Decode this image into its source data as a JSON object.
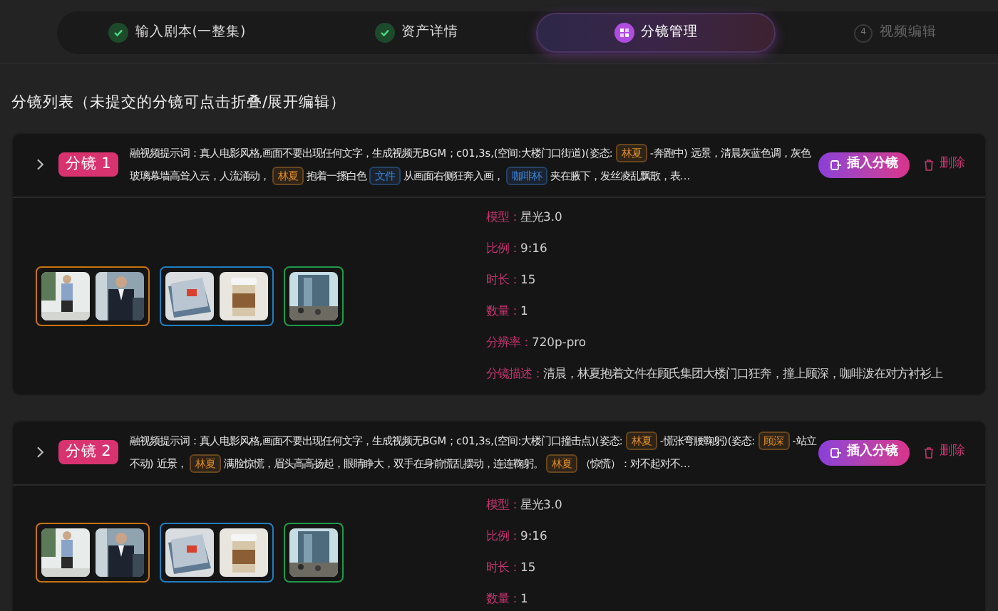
{
  "stepper": [
    {
      "label": "输入剧本(一整集)",
      "selected": false,
      "completed": true
    },
    {
      "label": "资产详情",
      "selected": false,
      "completed": true
    },
    {
      "label": "分镜管理",
      "selected": true,
      "completed": false
    },
    {
      "label": "视频编辑",
      "selected": false,
      "completed": false,
      "number": "4"
    }
  ],
  "list_title": "分镜列表（未提交的分镜可点击折叠/展开编辑）",
  "shots": [
    {
      "badge": "分镜 1",
      "insert_button": "插入分镜",
      "delete_button": "删除",
      "prompt": [
        {
          "kind": "text",
          "text": "融视频提示词：真人电影风格,画面不要出现任何文字，生成视频无BGM；c01,3s,(空间:大楼门口街道)(姿态:"
        },
        {
          "kind": "tag",
          "text": "林夏",
          "color": "#d98a2b"
        },
        {
          "kind": "text",
          "text": "-奔跑中) 远景，清晨灰蓝色调，灰色玻璃幕墙高耸入云，人流涌动，"
        },
        {
          "kind": "tag",
          "text": "林夏",
          "color": "#d98a2b"
        },
        {
          "kind": "text",
          "text": "抱着一摞白色"
        },
        {
          "kind": "tag",
          "text": "文件",
          "color": "#3b82d6"
        },
        {
          "kind": "text",
          "text": "从画面右侧狂奔入画，"
        },
        {
          "kind": "tag",
          "text": "咖啡杯",
          "color": "#3b82d6"
        },
        {
          "kind": "text",
          "text": "夹在腋下，发丝凌乱飘散，表…"
        }
      ],
      "image_groups": [
        {
          "color": "#c8740f"
        },
        {
          "color": "#1f7fc0"
        },
        {
          "color": "#1f9a4a"
        }
      ],
      "details": [
        {
          "label": "模型：",
          "value": "星光3.0"
        },
        {
          "label": "比例：",
          "value": "9:16"
        },
        {
          "label": "时长：",
          "value": "15"
        },
        {
          "label": "数量：",
          "value": "1"
        },
        {
          "label": "分辨率：",
          "value": "720p-pro"
        },
        {
          "label": "分镜描述：",
          "value": "清晨，林夏抱着文件在顾氏集团大楼门口狂奔，撞上顾深，咖啡泼在对方衬衫上"
        }
      ]
    },
    {
      "badge": "分镜 2",
      "insert_button": "插入分镜",
      "delete_button": "删除",
      "prompt": [
        {
          "kind": "text",
          "text": "融视频提示词：真人电影风格,画面不要出现任何文字，生成视频无BGM；c01,3s,(空间:大楼门口撞击点)(姿态:"
        },
        {
          "kind": "tag",
          "text": "林夏",
          "color": "#d98a2b"
        },
        {
          "kind": "text",
          "text": "-慌张弯腰鞠躬)(姿态:"
        },
        {
          "kind": "tag",
          "text": "顾深",
          "color": "#d98a2b"
        },
        {
          "kind": "text",
          "text": "-站立不动) 近景，"
        },
        {
          "kind": "tag",
          "text": "林夏",
          "color": "#d98a2b"
        },
        {
          "kind": "text",
          "text": "满脸惊慌，眉头高高扬起，眼睛睁大，双手在身前慌乱摆动，连连鞠躬。"
        },
        {
          "kind": "tag",
          "text": "林夏",
          "color": "#d98a2b"
        },
        {
          "kind": "text",
          "text": "（惊慌）：对不起对不…"
        }
      ],
      "image_groups": [
        {
          "color": "#c8740f"
        },
        {
          "color": "#1f7fc0"
        },
        {
          "color": "#1f9a4a"
        }
      ],
      "details": [
        {
          "label": "模型：",
          "value": "星光3.0"
        },
        {
          "label": "比例：",
          "value": "9:16"
        },
        {
          "label": "时长：",
          "value": "15"
        },
        {
          "label": "数量：",
          "value": "1"
        }
      ]
    }
  ]
}
